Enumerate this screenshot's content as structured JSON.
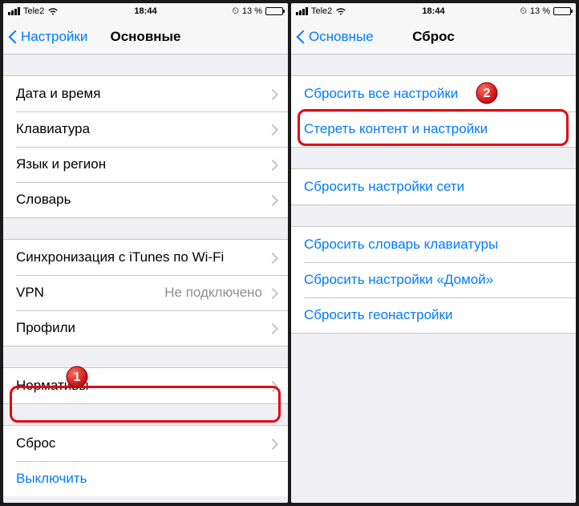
{
  "status": {
    "carrier": "Tele2",
    "time": "18:44",
    "battery_pct": "13 %"
  },
  "left": {
    "back": "Настройки",
    "title": "Основные",
    "g1": {
      "date_time": "Дата и время",
      "keyboard": "Клавиатура",
      "lang_region": "Язык и регион",
      "dictionary": "Словарь"
    },
    "g2": {
      "itunes_wifi": "Синхронизация с iTunes по Wi-Fi",
      "vpn": "VPN",
      "vpn_detail": "Не подключено",
      "profiles": "Профили"
    },
    "g3": {
      "regulatory": "Нормативы"
    },
    "g4": {
      "reset": "Сброс",
      "shutdown": "Выключить"
    },
    "badge": "1"
  },
  "right": {
    "back": "Основные",
    "title": "Сброс",
    "g1": {
      "reset_all": "Сбросить все настройки",
      "erase_all": "Стереть контент и настройки"
    },
    "g2": {
      "reset_network": "Сбросить настройки сети"
    },
    "g3": {
      "reset_kb_dict": "Сбросить словарь клавиатуры",
      "reset_home": "Сбросить настройки «Домой»",
      "reset_location": "Сбросить геонастройки"
    },
    "badge": "2"
  }
}
